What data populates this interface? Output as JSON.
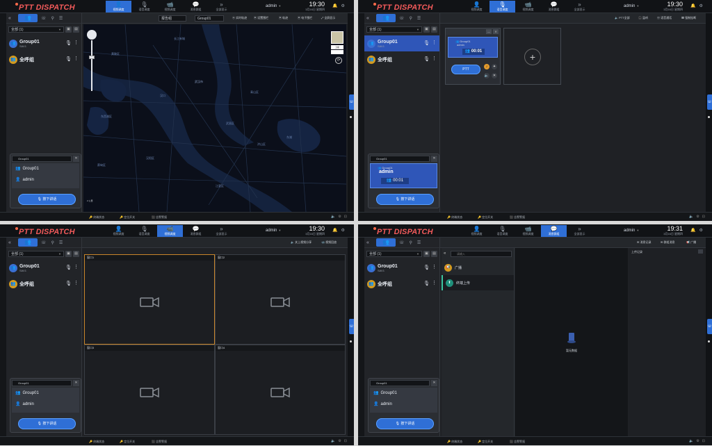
{
  "app": {
    "logo": "PTT DISPATCH",
    "user": "admin",
    "nav": [
      "视频调度",
      "语音调度",
      "视频调度",
      "消息群组",
      "全部显示"
    ]
  },
  "sidebar": {
    "filter": "全部 (1)",
    "groups": [
      {
        "name": "Group01",
        "sub": "SAV1"
      },
      {
        "name": "全呼组",
        "sub": ""
      }
    ]
  },
  "ptt_panel": {
    "group": "Group01",
    "members": [
      "Group01",
      "admin"
    ],
    "button": "按下讲话",
    "call_group": "Group01",
    "call_user": "admin",
    "call_time": "00:01"
  },
  "status_items": [
    "终端状态",
    "定位开关",
    "告警警报"
  ],
  "quadrants": [
    {
      "clock": "19:30",
      "date": "3月16日 星期四",
      "toolbar_sel1": "报告组",
      "toolbar_sel2": "Group01",
      "toolbar_btns": [
        "实时轨迹",
        "设置围栏",
        "轨迹",
        "电子围栏",
        "全屏显示"
      ],
      "map_labels": [
        "黄陂区",
        "长江新城",
        "武汉市",
        "汉口",
        "武昌区",
        "洪山区",
        "青山区",
        "东西湖区",
        "江夏区",
        "汉阳区",
        "蔡甸区",
        "东湖"
      ],
      "map_switch": "卫星",
      "scale": "2.公里"
    },
    {
      "clock": "19:30",
      "date": "3月16日 星期四",
      "toolbar_btns": [
        "PTT全部",
        "监听",
        "语音通话",
        "强制挂断"
      ],
      "card_group": "Group01",
      "card_user": "admin",
      "card_time": "00:01",
      "card_btn": "PTT"
    },
    {
      "clock": "19:30",
      "date": "3月16日 星期四",
      "toolbar_btns": [
        "关上视频分享",
        "视频回放"
      ],
      "cells": [
        "窗口1",
        "窗口2",
        "窗口3",
        "窗口4"
      ]
    },
    {
      "clock": "19:31",
      "date": "3月16日 星期四",
      "toolbar_btns": [
        "消息记录",
        "群组消息",
        "广播"
      ],
      "search_placeholder": "请输入",
      "items": [
        "广播",
        "终端上传"
      ],
      "upload_header": "上传记录",
      "empty": "暂无数据"
    }
  ],
  "colors": {
    "accent": "#2f6fd6",
    "selected": "#2f56b8",
    "background": "#1b1d21",
    "video_active": "#c9862a"
  }
}
